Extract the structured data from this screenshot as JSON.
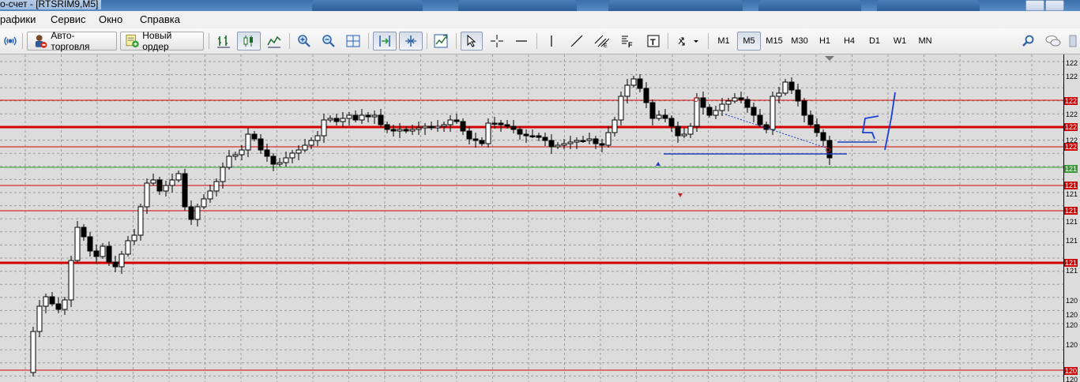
{
  "window": {
    "title": "о-счет - [RTSRIM9,M5]"
  },
  "menu": [
    "рафики",
    "Сервис",
    "Окно",
    "Справка"
  ],
  "toolbar": {
    "auto_trading": "Авто-торговля",
    "new_order": "Новый ордер",
    "timeframes": [
      "M1",
      "M5",
      "M15",
      "M30",
      "H1",
      "H4",
      "D1",
      "W1",
      "MN"
    ],
    "active_timeframe": "M5",
    "draw_letters": {
      "fibo": "F",
      "text": "T"
    }
  },
  "chart": {
    "symbol": "RTSRIM9",
    "period": "M5",
    "background": "#dcdcdc",
    "grid": true,
    "bull_candle": "#ffffff",
    "bear_candle": "#000000",
    "red_levels_thick": [
      161,
      333
    ],
    "red_levels_thin": [
      127,
      186,
      235,
      267,
      469
    ],
    "green_level": 212
  },
  "price_scale": {
    "labels": [
      {
        "text": "122",
        "kind": "plain"
      },
      {
        "text": "122",
        "kind": "plain"
      },
      {
        "text": "122",
        "kind": "tag"
      },
      {
        "text": "122",
        "kind": "plain"
      },
      {
        "text": "122",
        "kind": "tag"
      },
      {
        "text": "122",
        "kind": "plain"
      },
      {
        "text": "122",
        "kind": "tag"
      },
      {
        "text": "121",
        "kind": "tag-green"
      },
      {
        "text": "121",
        "kind": "tag"
      },
      {
        "text": "121",
        "kind": "plain"
      },
      {
        "text": "121",
        "kind": "tag"
      },
      {
        "text": "121",
        "kind": "plain"
      },
      {
        "text": "121",
        "kind": "plain"
      },
      {
        "text": "121",
        "kind": "tag"
      },
      {
        "text": "121",
        "kind": "plain"
      },
      {
        "text": "120",
        "kind": "plain"
      },
      {
        "text": "120",
        "kind": "plain"
      },
      {
        "text": "120",
        "kind": "plain"
      },
      {
        "text": "120",
        "kind": "plain"
      },
      {
        "text": "120",
        "kind": "tag"
      },
      {
        "text": "120",
        "kind": "plain"
      }
    ]
  }
}
